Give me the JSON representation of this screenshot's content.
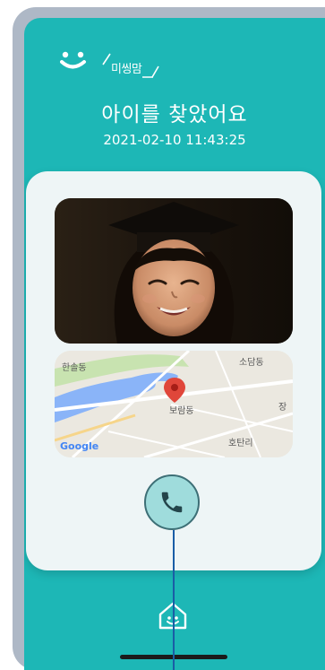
{
  "header": {
    "brand_name": "미씽맘",
    "title": "아이를 찾았어요",
    "datetime": "2021-02-10 11:43:25"
  },
  "map": {
    "labels": {
      "hansol": "한솔동",
      "sodam": "소담동",
      "boram": "보람동",
      "jang": "장",
      "hotan": "호탄리"
    },
    "attribution": "Google"
  },
  "icons": {
    "brand": "smiley-logo-icon",
    "pin": "map-pin-icon",
    "call": "phone-icon",
    "home": "home-icon"
  },
  "colors": {
    "primary": "#1db7b6",
    "card": "#eef5f6",
    "call_button": "#9fdcdc",
    "pin": "#e0463a"
  }
}
